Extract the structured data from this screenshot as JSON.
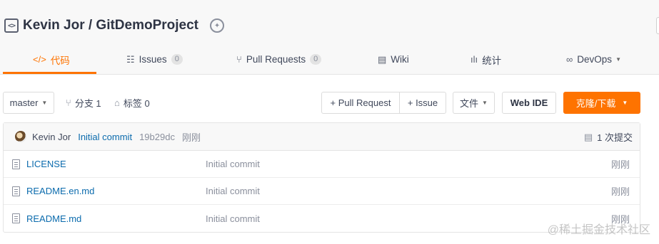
{
  "repo": {
    "title": "Kevin Jor / GitDemoProject"
  },
  "tabs": [
    {
      "label": "代码",
      "icon": "code-icon"
    },
    {
      "label": "Issues",
      "count": "0",
      "icon": "issues-icon"
    },
    {
      "label": "Pull Requests",
      "count": "0",
      "icon": "pull-request-icon"
    },
    {
      "label": "Wiki",
      "icon": "wiki-icon"
    },
    {
      "label": "统计",
      "icon": "stats-icon"
    },
    {
      "label": "DevOps",
      "icon": "devops-icon"
    }
  ],
  "toolbar": {
    "branch": "master",
    "branches": "分支 1",
    "tags": "标签 0",
    "pull_request": "+ Pull Request",
    "issue": "+ Issue",
    "file": "文件",
    "web_ide": "Web IDE",
    "clone": "克隆/下载"
  },
  "commit": {
    "author": "Kevin Jor",
    "message": "Initial commit",
    "sha": "19b29dc",
    "time": "刚刚",
    "count": "1 次提交"
  },
  "files": [
    {
      "name": "LICENSE",
      "message": "Initial commit",
      "time": "刚刚"
    },
    {
      "name": "README.en.md",
      "message": "Initial commit",
      "time": "刚刚"
    },
    {
      "name": "README.md",
      "message": "Initial commit",
      "time": "刚刚"
    }
  ],
  "watermark": "@稀土掘金技术社区",
  "colors": {
    "accent": "#fe7300",
    "link": "#0b6bad"
  }
}
